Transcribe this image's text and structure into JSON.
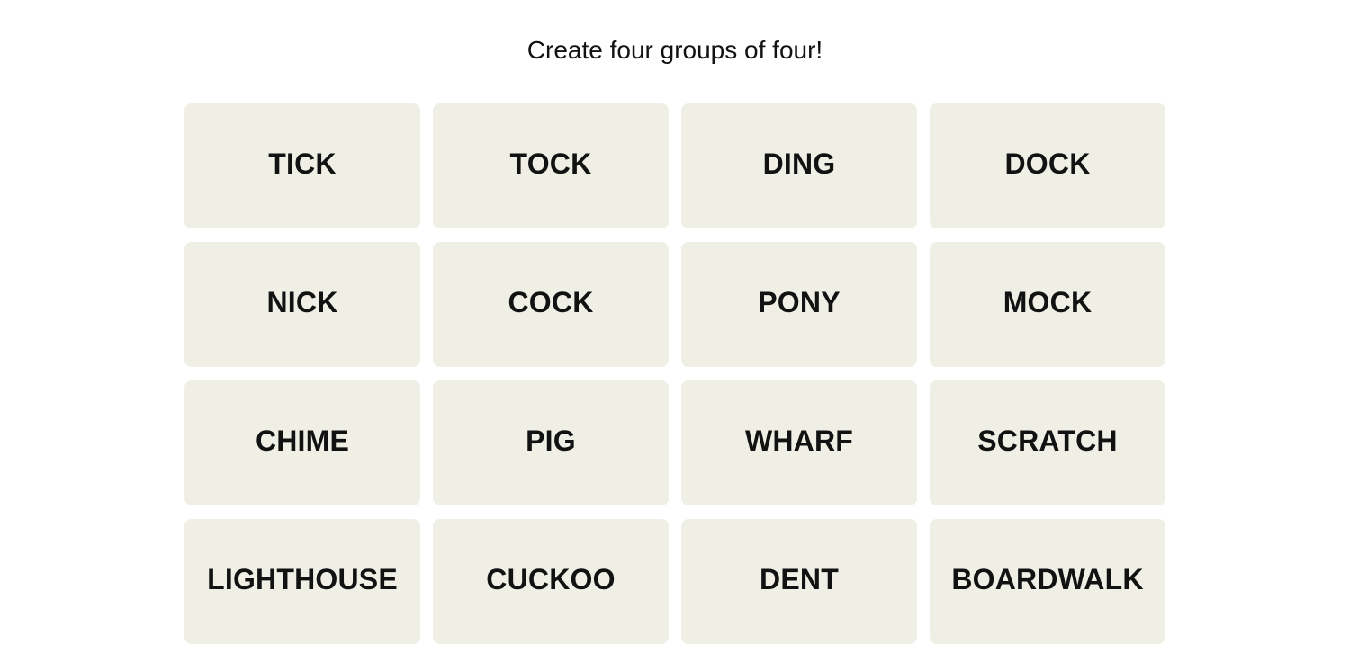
{
  "header": {
    "prompt": "Create four groups of four!"
  },
  "tiles": [
    [
      "TICK",
      "TOCK",
      "DING",
      "DOCK"
    ],
    [
      "NICK",
      "COCK",
      "PONY",
      "MOCK"
    ],
    [
      "CHIME",
      "PIG",
      "WHARF",
      "SCRATCH"
    ],
    [
      "LIGHTHOUSE",
      "CUCKOO",
      "DENT",
      "BOARDWALK"
    ]
  ],
  "colors": {
    "tile_bg": "#efefe6",
    "text": "#121212",
    "page_bg": "#ffffff"
  }
}
